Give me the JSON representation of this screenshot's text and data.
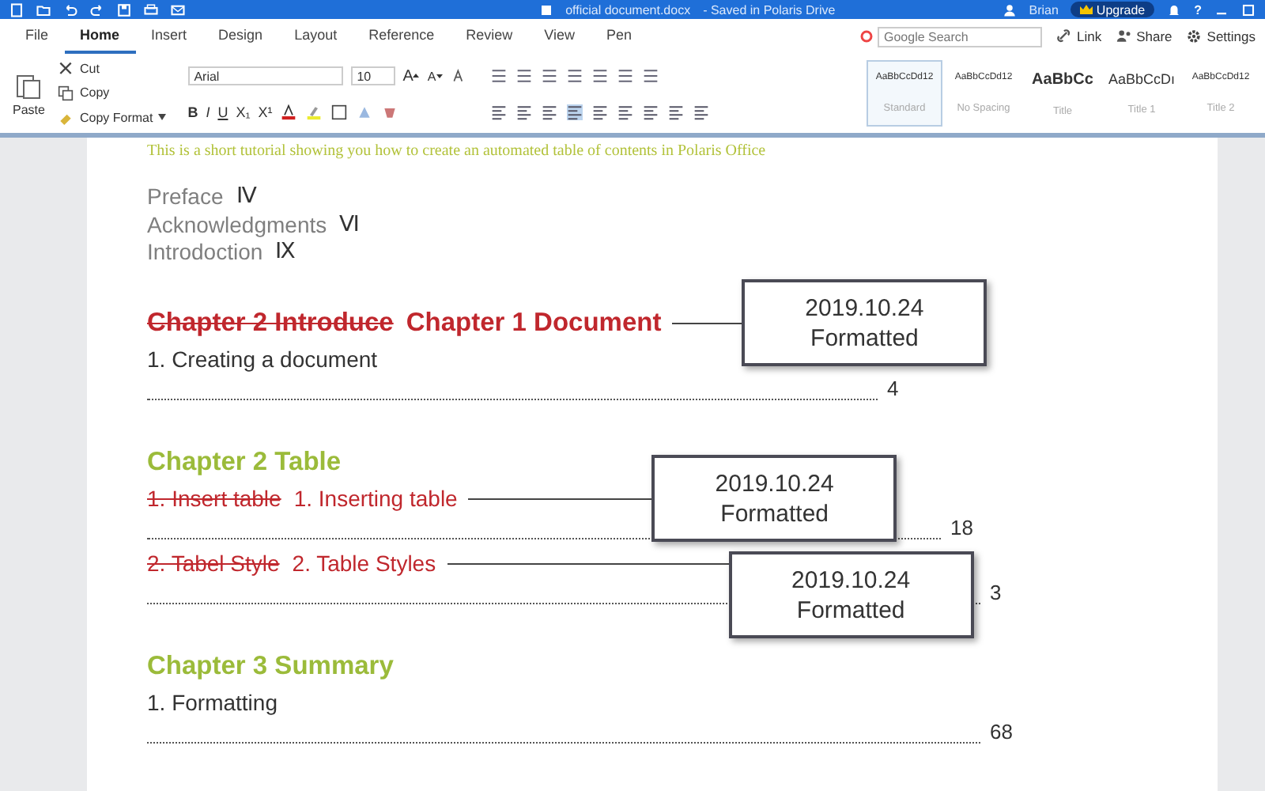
{
  "title_bar": {
    "document": "official document.docx",
    "status": "- Saved in Polaris Drive",
    "user": "Brian",
    "upgrade": "Upgrade",
    "help": "?"
  },
  "tabs": [
    {
      "label": "File",
      "selected": false
    },
    {
      "label": "Home",
      "selected": true
    },
    {
      "label": "Insert",
      "selected": false
    },
    {
      "label": "Design",
      "selected": false
    },
    {
      "label": "Layout",
      "selected": false
    },
    {
      "label": "Reference",
      "selected": false
    },
    {
      "label": "Review",
      "selected": false
    },
    {
      "label": "View",
      "selected": false
    },
    {
      "label": "Pen",
      "selected": false
    }
  ],
  "search": {
    "placeholder": "Google Search"
  },
  "actions": [
    "Link",
    "Share",
    "Settings"
  ],
  "clipboard": {
    "paste": "Paste",
    "cut": "Cut",
    "copy": "Copy",
    "copy_format": "Copy Format"
  },
  "font": {
    "family": "Arial",
    "size": "10"
  },
  "size_buttons": [
    "A",
    "A"
  ],
  "format_buttons": [
    "B",
    "I",
    "U",
    "X₁",
    "X¹"
  ],
  "styles": [
    {
      "sample": "AaBbCcDd12",
      "name": "Standard",
      "selected": true,
      "kind": "small"
    },
    {
      "sample": "AaBbCcDd12",
      "name": "No Spacing",
      "selected": false,
      "kind": "small"
    },
    {
      "sample": "AaBbCc",
      "name": "Title",
      "selected": false,
      "kind": "title"
    },
    {
      "sample": "AaBbCcDı",
      "name": "Title 1",
      "selected": false,
      "kind": "heading"
    },
    {
      "sample": "AaBbCcDd12",
      "name": "Title 2",
      "selected": false,
      "kind": "small"
    }
  ],
  "document": {
    "intro": "This is a short tutorial showing you how to create an automated table of contents in Polaris Office",
    "front_matter": [
      {
        "label": "Preface",
        "numeral": "Ⅳ"
      },
      {
        "label": "Acknowledgments",
        "numeral": "Ⅵ"
      },
      {
        "label": "Introdoction",
        "numeral": "Ⅸ"
      }
    ],
    "items": [
      {
        "kind": "heading",
        "deleted": "Chapter 2 Introduce",
        "text": "Chapter 1 Document",
        "callout": {
          "date": "2019.10.24",
          "status": "Formatted"
        }
      },
      {
        "kind": "entry",
        "text": "1. Creating a document",
        "page": "4"
      },
      {
        "kind": "heading",
        "text": "Chapter 2 Table"
      },
      {
        "kind": "entry",
        "deleted": "1. Insert table",
        "text": "1. Inserting table",
        "page": "18",
        "callout": {
          "date": "2019.10.24",
          "status": "Formatted"
        }
      },
      {
        "kind": "entry",
        "deleted": "2. Tabel Style",
        "text": "2. Table Styles",
        "page": "3",
        "callout": {
          "date": "2019.10.24",
          "status": "Formatted"
        }
      },
      {
        "kind": "heading",
        "text": "Chapter 3 Summary"
      },
      {
        "kind": "entry",
        "text": "1. Formatting",
        "page": "68"
      }
    ]
  }
}
